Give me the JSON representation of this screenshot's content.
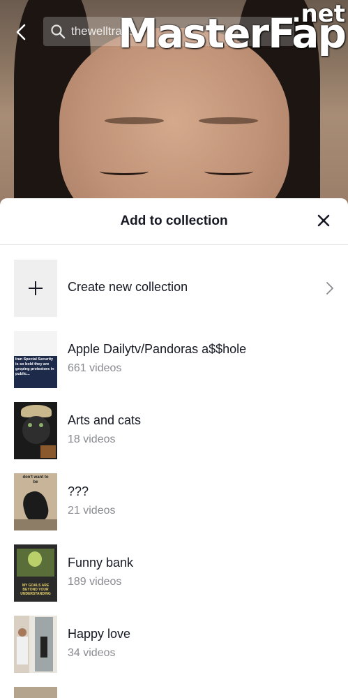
{
  "topbar": {
    "search_text": "thewelltrave"
  },
  "watermark": {
    "main": "MasterFap",
    "tld": ".net"
  },
  "sheet": {
    "title": "Add to collection",
    "create_label": "Create new collection"
  },
  "collections": [
    {
      "name": "Apple Dailytv/Pandoras a$$hole",
      "count": "661 videos",
      "thumb_caption": "Iran Special Security is so bold they are groping protestors in public..."
    },
    {
      "name": "Arts and cats",
      "count": "18 videos"
    },
    {
      "name": "???",
      "count": "21 videos",
      "thumb_caption": "don't want to be"
    },
    {
      "name": "Funny bank",
      "count": "189 videos",
      "thumb_caption": "MY GOALS ARE BEYOND YOUR UNDERSTANDING"
    },
    {
      "name": "Happy love",
      "count": "34 videos"
    }
  ],
  "colors": {
    "sheet_bg": "#ffffff",
    "title_text": "#161823",
    "secondary_text": "#8a8b91"
  }
}
